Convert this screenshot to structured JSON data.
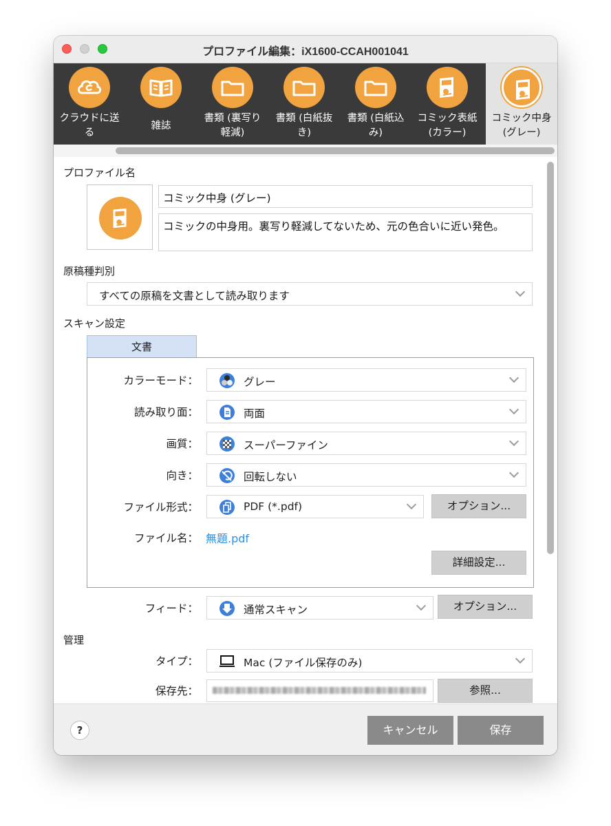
{
  "window": {
    "title": "プロファイル編集：iX1600-CCAH001041"
  },
  "profiles": [
    {
      "label": "クラウドに送\nる",
      "icon": "cloud-send-icon"
    },
    {
      "label": "雑誌",
      "icon": "book-icon"
    },
    {
      "label": "書類 (裏写り\n軽減)",
      "icon": "folder-icon"
    },
    {
      "label": "書類 (白紙抜\nき)",
      "icon": "folder-icon"
    },
    {
      "label": "書類 (白紙込\nみ)",
      "icon": "folder-icon"
    },
    {
      "label": "コミック表紙\n(カラー)",
      "icon": "comic-icon"
    },
    {
      "label": "コミック中身\n(グレー)",
      "icon": "comic-icon",
      "active": true
    }
  ],
  "profile": {
    "section_label": "プロファイル名",
    "name": "コミック中身 (グレー)",
    "description": "コミックの中身用。裏写り軽減してないため、元の色合いに近い発色。"
  },
  "detection": {
    "section_label": "原稿種判別",
    "value": "すべての原稿を文書として読み取ります"
  },
  "scan": {
    "section_label": "スキャン設定",
    "tab_label": "文書",
    "color_mode": {
      "label": "カラーモード：",
      "value": "グレー"
    },
    "sides": {
      "label": "読み取り面：",
      "value": "両面"
    },
    "quality": {
      "label": "画質：",
      "value": "スーパーファイン"
    },
    "orientation": {
      "label": "向き：",
      "value": "回転しない"
    },
    "file_format": {
      "label": "ファイル形式：",
      "value": "PDF (*.pdf)",
      "option_button": "オプション..."
    },
    "file_name": {
      "label": "ファイル名：",
      "value": "無題.pdf"
    },
    "detail_button": "詳細設定...",
    "feed": {
      "label": "フィード：",
      "value": "通常スキャン",
      "option_button": "オプション..."
    }
  },
  "management": {
    "section_label": "管理",
    "type": {
      "label": "タイプ：",
      "value": "Mac (ファイル保存のみ)"
    },
    "destination": {
      "label": "保存先：",
      "browse_button": "参照..."
    }
  },
  "footer": {
    "help": "?",
    "cancel": "キャンセル",
    "save": "保存"
  },
  "colors": {
    "accent_orange": "#f0a33f",
    "toolbar_bg": "#3a3a3a",
    "tab_blue": "#d5e2f6",
    "link_blue": "#2f8fe0",
    "footer_button": "#8a8a8a"
  }
}
